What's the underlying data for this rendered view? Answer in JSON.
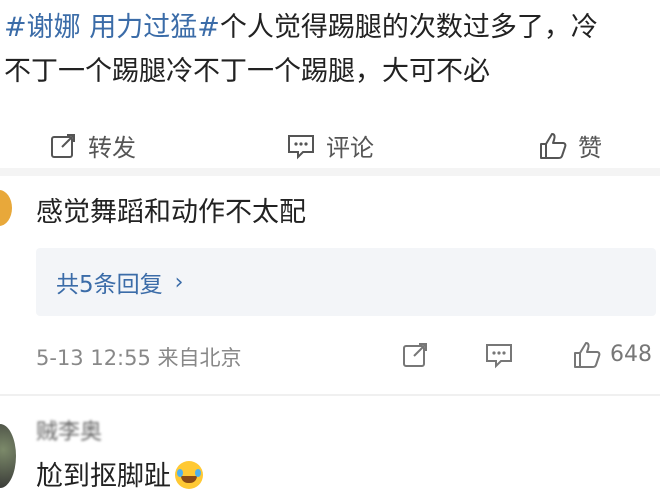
{
  "post": {
    "tag1": "#谢娜",
    "tag2": "用力过猛#",
    "text_line1": "个人觉得踢腿的次数过多了，冷",
    "text_line2": "不丁一个踢腿冷不丁一个踢腿，大可不必"
  },
  "actions": {
    "repost_label": "转发",
    "comment_label": "评论",
    "like_label": "赞"
  },
  "comments": [
    {
      "text": "感觉舞蹈和动作不太配",
      "replies_label": "共5条回复",
      "time": "5-13 12:55",
      "source": "来自北京",
      "like_count": "648"
    },
    {
      "user_name": "贼李奥",
      "text": "尬到抠脚趾",
      "emoji": "laughing-crying-emoji"
    }
  ],
  "colors": {
    "link_blue": "#3b6ca8",
    "reply_box_bg": "#f3f5f8",
    "meta_gray": "#888888"
  }
}
